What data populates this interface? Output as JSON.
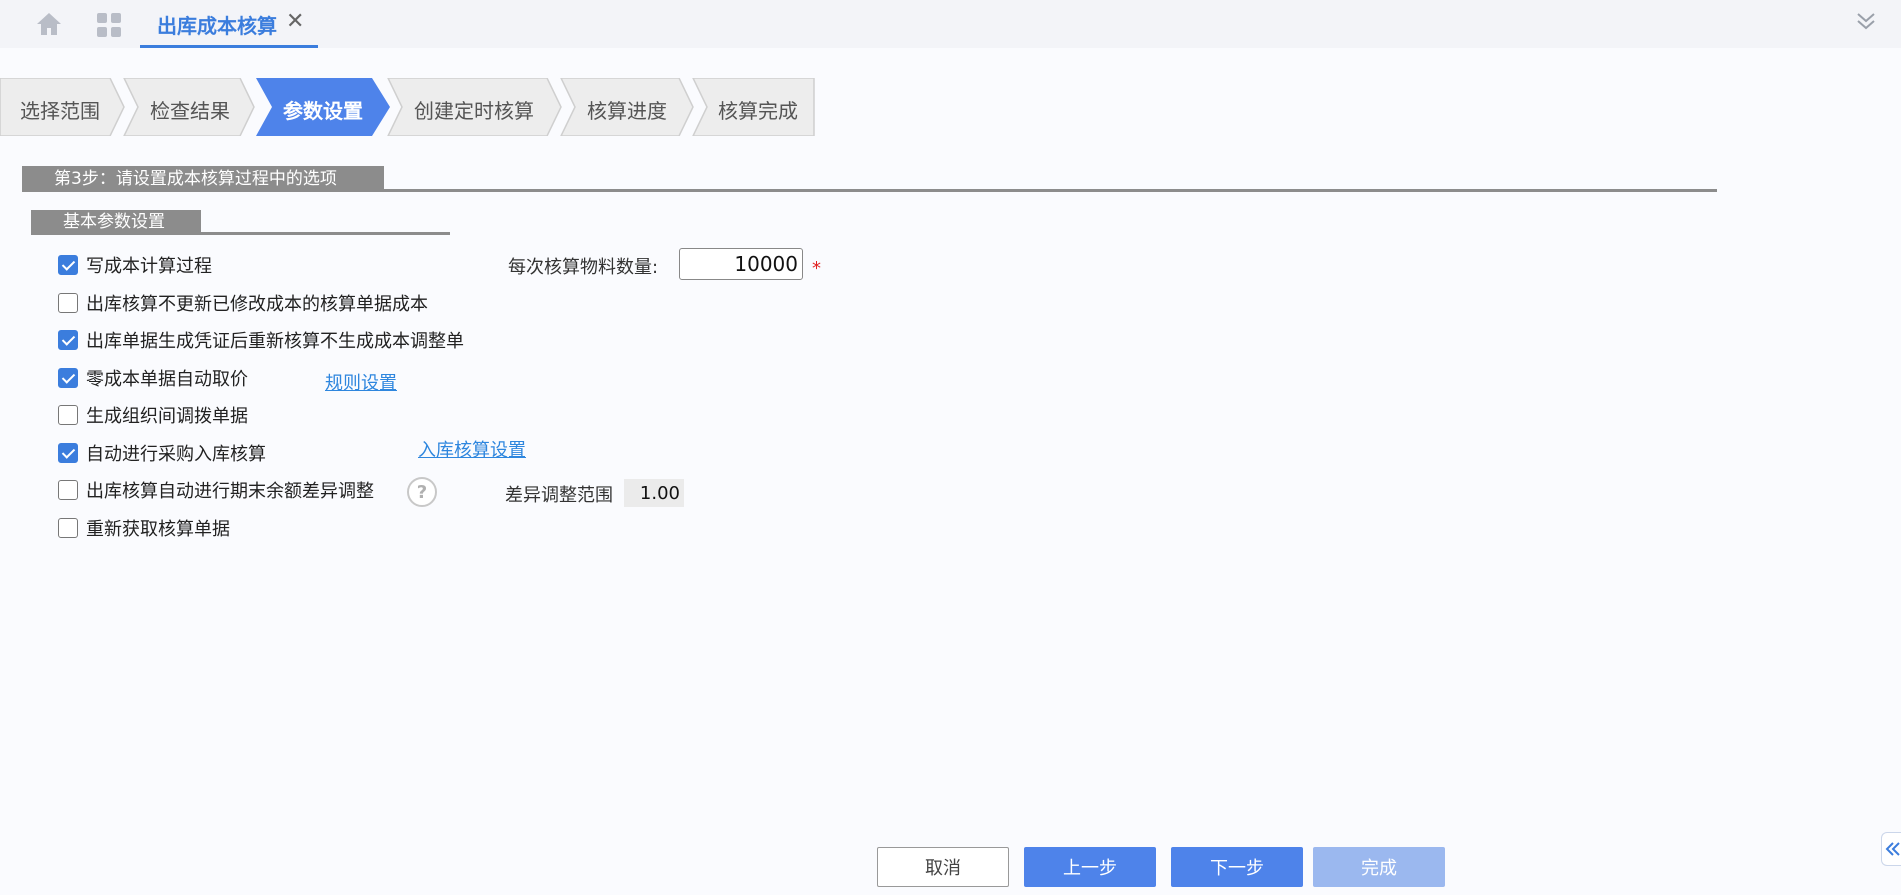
{
  "tab": {
    "title": "出库成本核算",
    "close": "✕"
  },
  "steps": [
    {
      "label": "选择范围",
      "active": false
    },
    {
      "label": "检查结果",
      "active": false
    },
    {
      "label": "参数设置",
      "active": true
    },
    {
      "label": "创建定时核算",
      "active": false
    },
    {
      "label": "核算进度",
      "active": false
    },
    {
      "label": "核算完成",
      "active": false
    }
  ],
  "section": {
    "title": "第3步：请设置成本核算过程中的选项",
    "sub_title": "基本参数设置"
  },
  "options": [
    {
      "label": "写成本计算过程",
      "checked": true
    },
    {
      "label": "出库核算不更新已修改成本的核算单据成本",
      "checked": false
    },
    {
      "label": "出库单据生成凭证后重新核算不生成成本调整单",
      "checked": true
    },
    {
      "label": "零成本单据自动取价",
      "checked": true
    },
    {
      "label": "生成组织间调拨单据",
      "checked": false
    },
    {
      "label": "自动进行采购入库核算",
      "checked": true
    },
    {
      "label": "出库核算自动进行期末余额差异调整",
      "checked": false
    },
    {
      "label": "重新获取核算单据",
      "checked": false
    }
  ],
  "links": {
    "rule_settings": "规则设置",
    "inbound_settings": "入库核算设置"
  },
  "quantity": {
    "label": "每次核算物料数量:",
    "value": "10000",
    "required_mark": "*"
  },
  "diff_range": {
    "label": "差异调整范围",
    "value": "1.00"
  },
  "buttons": {
    "cancel": "取消",
    "prev": "上一步",
    "next": "下一步",
    "finish": "完成"
  },
  "colors": {
    "accent": "#3b7ddd",
    "step_active": "#4e83ea",
    "step_inactive": "#ededed",
    "header_gray": "#8c8c8c"
  },
  "icons": {
    "home": "home-icon",
    "apps": "apps-grid-icon",
    "collapse": "double-chevron-down-icon",
    "help": "question-circle-icon",
    "side": "double-chevron-left-icon"
  }
}
